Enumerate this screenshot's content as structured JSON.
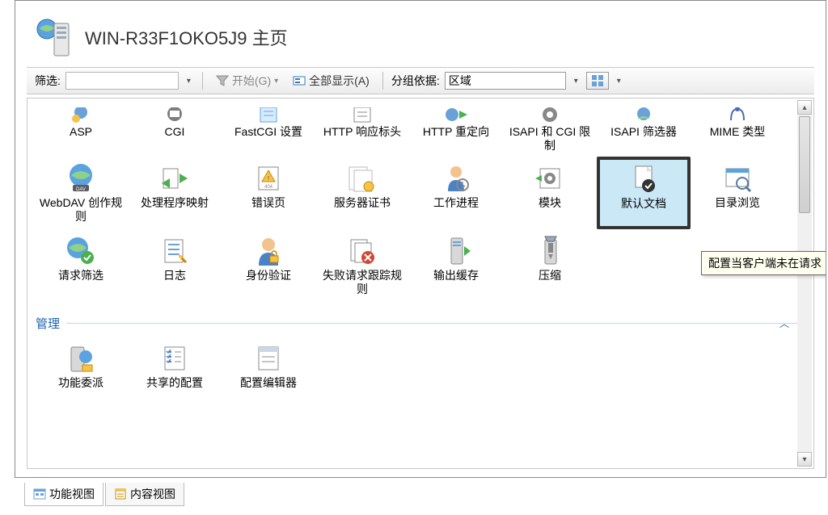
{
  "header": {
    "title": "WIN-R33F1OKO5J9 主页"
  },
  "toolbar": {
    "filter_label": "筛选:",
    "filter_value": "",
    "go_label": "开始(G)",
    "showall_label": "全部显示(A)",
    "group_label": "分组依据:",
    "group_value": "区域"
  },
  "iis_row1": [
    {
      "name": "asp",
      "label": "ASP"
    },
    {
      "name": "cgi",
      "label": "CGI"
    },
    {
      "name": "fastcgi",
      "label": "FastCGI 设置"
    },
    {
      "name": "http-response",
      "label": "HTTP 响应标头"
    },
    {
      "name": "http-redirect",
      "label": "HTTP 重定向"
    },
    {
      "name": "isapi-cgi",
      "label": "ISAPI 和 CGI 限制"
    },
    {
      "name": "isapi-filter",
      "label": "ISAPI 筛选器"
    },
    {
      "name": "mime",
      "label": "MIME 类型"
    }
  ],
  "iis_row2": [
    {
      "name": "webdav",
      "label": "WebDAV 创作规则"
    },
    {
      "name": "handler",
      "label": "处理程序映射"
    },
    {
      "name": "error-pages",
      "label": "错误页"
    },
    {
      "name": "server-cert",
      "label": "服务器证书"
    },
    {
      "name": "worker",
      "label": "工作进程"
    },
    {
      "name": "modules",
      "label": "模块"
    },
    {
      "name": "default-doc",
      "label": "默认文档",
      "selected": true
    },
    {
      "name": "dir-browse",
      "label": "目录浏览"
    }
  ],
  "iis_row3": [
    {
      "name": "request-filter",
      "label": "请求筛选"
    },
    {
      "name": "logging",
      "label": "日志"
    },
    {
      "name": "auth",
      "label": "身份验证"
    },
    {
      "name": "failed-trace",
      "label": "失败请求跟踪规则"
    },
    {
      "name": "output-cache",
      "label": "输出缓存"
    },
    {
      "name": "compression",
      "label": "压缩"
    }
  ],
  "mgmt_header": "管理",
  "mgmt_row": [
    {
      "name": "feature-delegation",
      "label": "功能委派"
    },
    {
      "name": "shared-config",
      "label": "共享的配置"
    },
    {
      "name": "config-editor",
      "label": "配置编辑器"
    }
  ],
  "tooltip": "配置当客户端未在请求",
  "tabs": {
    "features": "功能视图",
    "content": "内容视图"
  }
}
